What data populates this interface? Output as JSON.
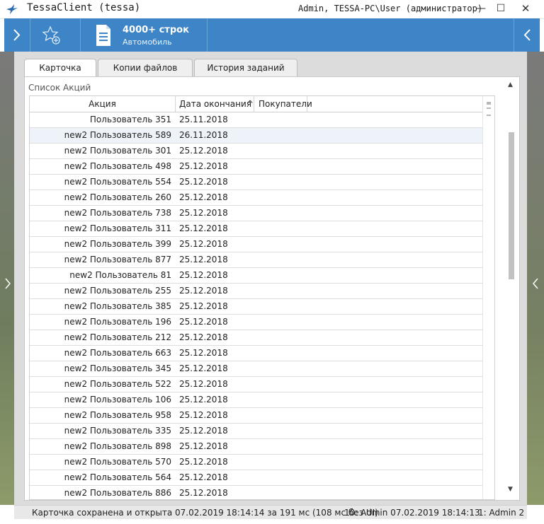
{
  "window": {
    "title": "TessaClient (tessa)",
    "user": "Admin, TESSA-PC\\User (администратор)",
    "min": "—",
    "max": "☐",
    "close": "✕"
  },
  "ribbon": {
    "card_title": "4000+ строк",
    "card_subtitle": "Автомобиль",
    "accent": "#3d85c6"
  },
  "tabs": [
    "Карточка",
    "Копии файлов",
    "История заданий"
  ],
  "list": {
    "title": "Список Акций",
    "columns": [
      "Акция",
      "Дата окончания",
      "Покупатели"
    ],
    "sort_indicator": "^",
    "rows": [
      {
        "action": "Пользователь 351",
        "date": "25.11.2018"
      },
      {
        "action": "new2 Пользователь 589",
        "date": "26.11.2018"
      },
      {
        "action": "new2 Пользователь 301",
        "date": "25.12.2018"
      },
      {
        "action": "new2 Пользователь 498",
        "date": "25.12.2018"
      },
      {
        "action": "new2 Пользователь 554",
        "date": "25.12.2018"
      },
      {
        "action": "new2 Пользователь 260",
        "date": "25.12.2018"
      },
      {
        "action": "new2 Пользователь 738",
        "date": "25.12.2018"
      },
      {
        "action": "new2 Пользователь 311",
        "date": "25.12.2018"
      },
      {
        "action": "new2 Пользователь 399",
        "date": "25.12.2018"
      },
      {
        "action": "new2 Пользователь 877",
        "date": "25.12.2018"
      },
      {
        "action": "new2 Пользователь 81",
        "date": "25.12.2018"
      },
      {
        "action": "new2 Пользователь 255",
        "date": "25.12.2018"
      },
      {
        "action": "new2 Пользователь 385",
        "date": "25.12.2018"
      },
      {
        "action": "new2 Пользователь 196",
        "date": "25.12.2018"
      },
      {
        "action": "new2 Пользователь 212",
        "date": "25.12.2018"
      },
      {
        "action": "new2 Пользователь 663",
        "date": "25.12.2018"
      },
      {
        "action": "new2 Пользователь 345",
        "date": "25.12.2018"
      },
      {
        "action": "new2 Пользователь 522",
        "date": "25.12.2018"
      },
      {
        "action": "new2 Пользователь 106",
        "date": "25.12.2018"
      },
      {
        "action": "new2 Пользователь 958",
        "date": "25.12.2018"
      },
      {
        "action": "new2 Пользователь 335",
        "date": "25.12.2018"
      },
      {
        "action": "new2 Пользователь 898",
        "date": "25.12.2018"
      },
      {
        "action": "new2 Пользователь 570",
        "date": "25.12.2018"
      },
      {
        "action": "new2 Пользователь 564",
        "date": "25.12.2018"
      },
      {
        "action": "new2 Пользователь 886",
        "date": "25.12.2018"
      }
    ]
  },
  "status": {
    "message": "Карточка сохранена и открыта 07.02.2019 18:14:14 за 191 мс (108 мс без UI)",
    "mid": "10:  Admin  07.02.2019 18:14:13",
    "right": "1:  Admin  2"
  },
  "icons": {
    "app": "tessa-bird-icon",
    "favorite_add": "star-add-icon",
    "card": "document-icon"
  }
}
